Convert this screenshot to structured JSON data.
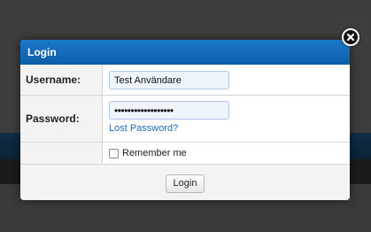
{
  "dialog": {
    "title": "Login",
    "username_label": "Username:",
    "username_value": "Test Användare",
    "password_label": "Password:",
    "password_value": "••••••••••••••••••",
    "lost_password_link": "Lost Password?",
    "remember_me_label": "Remember me",
    "remember_me_checked": false,
    "login_button": "Login",
    "close_icon": "close-icon"
  },
  "colors": {
    "header_blue": "#0d5ea8",
    "link_blue": "#1d6bb8",
    "input_background": "#eef4fb",
    "overlay": "#3e3e3e"
  }
}
